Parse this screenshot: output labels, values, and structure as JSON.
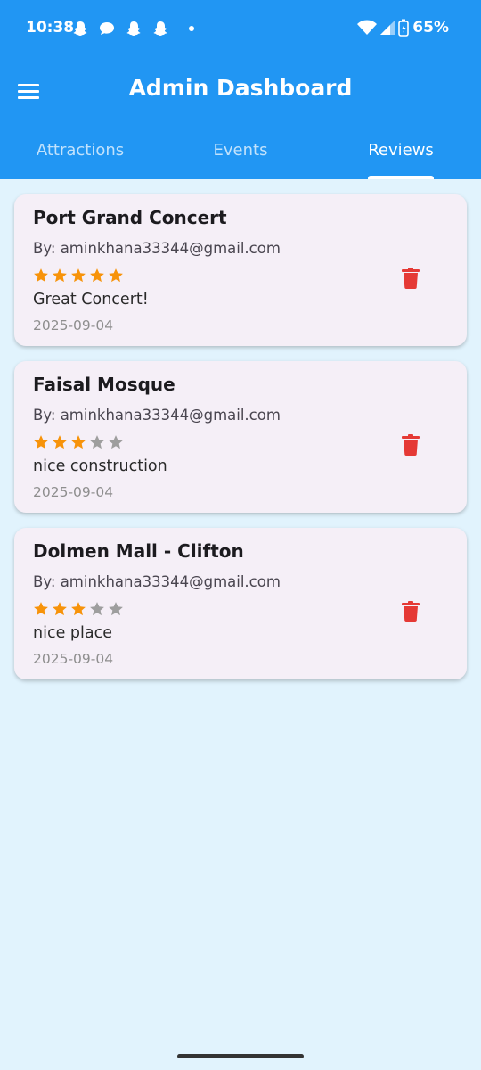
{
  "status_bar": {
    "time": "10:38",
    "battery": "65%"
  },
  "app_bar": {
    "title": "Admin Dashboard",
    "menu_icon": "hamburger-menu-icon"
  },
  "tabs": [
    {
      "label": "Attractions",
      "active": false
    },
    {
      "label": "Events",
      "active": false
    },
    {
      "label": "Reviews",
      "active": true
    }
  ],
  "reviews": [
    {
      "title": "Port Grand Concert",
      "by": "By: aminkhana33344@gmail.com",
      "rating": 5,
      "max_rating": 5,
      "comment": "Great Concert!",
      "date": "2025-09-04"
    },
    {
      "title": "Faisal Mosque",
      "by": "By: aminkhana33344@gmail.com",
      "rating": 3,
      "max_rating": 5,
      "comment": "nice construction",
      "date": "2025-09-04"
    },
    {
      "title": "Dolmen Mall - Clifton",
      "by": "By: aminkhana33344@gmail.com",
      "rating": 3,
      "max_rating": 5,
      "comment": "nice place",
      "date": "2025-09-04"
    }
  ],
  "colors": {
    "primary": "#2196f3",
    "background": "#e1f3fd",
    "card": "#f5eff7",
    "star_filled": "#f7930a",
    "star_empty": "#9e9e9e",
    "delete": "#e53935"
  }
}
